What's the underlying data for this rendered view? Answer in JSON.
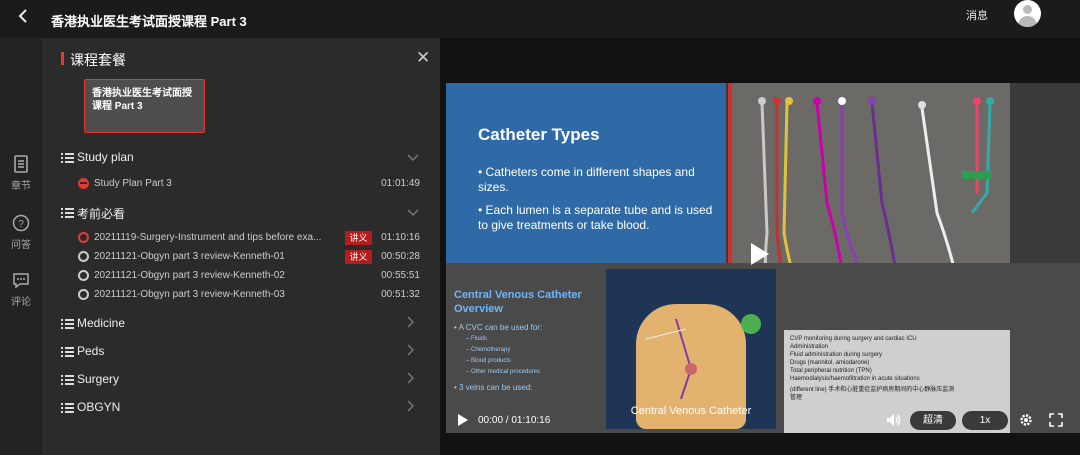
{
  "topbar": {
    "title": "香港执业医生考试面授课程 Part 3",
    "messages": "消息"
  },
  "rail": [
    {
      "label": "章节",
      "icon": "chapter-icon"
    },
    {
      "label": "问答",
      "icon": "question-icon"
    },
    {
      "label": "评论",
      "icon": "comment-icon"
    }
  ],
  "panel": {
    "title": "课程套餐",
    "package_name": "香港执业医生考试面授课程 Part 3",
    "sections": [
      {
        "label": "Study plan",
        "expanded": true,
        "items": [
          {
            "name": "Study Plan Part 3",
            "duration": "01:01:49",
            "status": "partial"
          }
        ]
      },
      {
        "label": "考前必看",
        "expanded": true,
        "items": [
          {
            "name": "20211119-Surgery-Instrument and tips before exa...",
            "badge": "讲义",
            "duration": "01:10:16",
            "status": "playing"
          },
          {
            "name": "20211121-Obgyn part 3 review-Kenneth-01",
            "badge": "讲义",
            "duration": "00:50:28",
            "status": "none"
          },
          {
            "name": "20211121-Obgyn part 3 review-Kenneth-02",
            "badge": "",
            "duration": "00:55:51",
            "status": "none"
          },
          {
            "name": "20211121-Obgyn part 3 review-Kenneth-03",
            "badge": "",
            "duration": "00:51:32",
            "status": "none"
          }
        ]
      },
      {
        "label": "Medicine",
        "expanded": false,
        "items": []
      },
      {
        "label": "Peds",
        "expanded": false,
        "items": []
      },
      {
        "label": "Surgery",
        "expanded": false,
        "items": []
      },
      {
        "label": "OBGYN",
        "expanded": false,
        "items": []
      }
    ]
  },
  "slide": {
    "title": "Catheter Types",
    "bullets": [
      "•  Catheters come in different shapes and sizes.",
      "•  Each lumen is a separate tube and is used to give treatments or take blood."
    ],
    "cvc_title": "Central Venous Catheter Overview",
    "cvc_lines": [
      "•  A CVC can be used for:",
      "•  3 veins can be used:"
    ],
    "cvc_subs": [
      "– Fluids",
      "– Chemotherapy",
      "– Blood products",
      "– Other medical procedures"
    ],
    "anatomy_caption": "Central Venous Catheter",
    "right_text": [
      "CVP monitoring during surgery and cardiac ICU",
      "Administration",
      "Fluid administration during surgery",
      "Drugs (mannitol, amiodarone)",
      "Total peripheral nutrition (TPN)",
      "Haemodialysis/haemofiltration in acute situations",
      "(different line) 手术和心脏重症监护病房期间的中心静脉压监测",
      "管理"
    ]
  },
  "controls": {
    "time": "00:00 / 01:10:16",
    "quality": "超清",
    "speed": "1x",
    "progress": 0
  },
  "colors": {
    "accent": "#e53935",
    "slide_blue": "#2f6aa6",
    "cvc_title": "#6db6ff"
  }
}
